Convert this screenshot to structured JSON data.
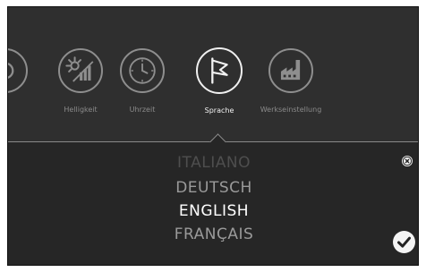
{
  "menu": {
    "tiles": [
      {
        "label": "Helligkeit",
        "icon": "brightness-icon"
      },
      {
        "label": "Uhrzeit",
        "icon": "clock-icon"
      },
      {
        "label": "Sprache",
        "icon": "flag-icon",
        "selected": true
      },
      {
        "label": "Werkseinstellung",
        "icon": "factory-icon"
      }
    ],
    "partial_tile_icon": "partial-tile-icon"
  },
  "language_picker": {
    "options": [
      "ITALIANO",
      "DEUTSCH",
      "ENGLISH",
      "FRANÇAIS"
    ],
    "selected": "ENGLISH"
  },
  "actions": {
    "close_icon": "close-icon",
    "confirm_icon": "checkmark-icon"
  },
  "colors": {
    "panel_top": "#2f2f2f",
    "panel_bottom": "#262626",
    "text_active": "#f2f2f2",
    "text_dim": "#8a8a8a",
    "text_faded": "#4e4e4e"
  }
}
